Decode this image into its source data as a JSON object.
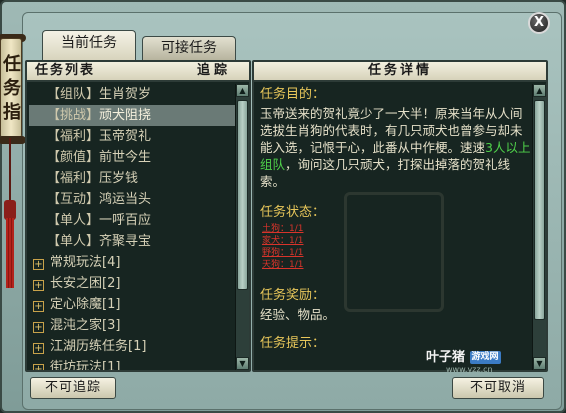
{
  "window": {
    "close_label": "X"
  },
  "side_scroll": {
    "chars": [
      "任",
      "务",
      "指"
    ]
  },
  "tabs": {
    "current": "当前任务",
    "available": "可接任务"
  },
  "left_panel": {
    "header_title": "任务列表",
    "header_track": "追踪",
    "tasks": [
      {
        "category": "【组队】",
        "name": "生肖贺岁",
        "selected": false
      },
      {
        "category": "【挑战】",
        "name": "顽犬阻挠",
        "selected": true
      },
      {
        "category": "【福利】",
        "name": "玉帝贺礼",
        "selected": false
      },
      {
        "category": "【颜值】",
        "name": "前世今生",
        "selected": false
      },
      {
        "category": "【福利】",
        "name": "压岁钱",
        "selected": false
      },
      {
        "category": "【互动】",
        "name": "鸿运当头",
        "selected": false
      },
      {
        "category": "【单人】",
        "name": "一呼百应",
        "selected": false
      },
      {
        "category": "【单人】",
        "name": "齐聚寻宝",
        "selected": false
      }
    ],
    "groups": [
      {
        "icon": "plus-icon",
        "label": "常规玩法[4]"
      },
      {
        "icon": "plus-icon",
        "label": "长安之困[2]"
      },
      {
        "icon": "plus-icon",
        "label": "定心除魔[1]"
      },
      {
        "icon": "plus-icon",
        "label": "混沌之家[3]"
      },
      {
        "icon": "plus-icon",
        "label": "江湖历练任务[1]"
      },
      {
        "icon": "plus-icon",
        "label": "街坊玩法[1]"
      }
    ]
  },
  "right_panel": {
    "header_title": "任务详情",
    "goal_title": "任务目的：",
    "goal_text_1": "玉帝送来的贺礼竟少了一大半！原来当年从人间选拔生肖狗的代表时，有几只顽犬也曾参与却未能入选，记恨于心，此番从中作梗。速速",
    "goal_text_green": "3人以上组队",
    "goal_text_2": "，询问这几只顽犬，打探出掉落的贺礼线索。",
    "status_title": "任务状态：",
    "status_lines": [
      "土狗：1/1",
      "家犬：1/1",
      "野狗：1/1",
      "天狗：1/1"
    ],
    "reward_title": "任务奖励：",
    "reward_text": "经验、物品。",
    "tip_title": "任务提示："
  },
  "buttons": {
    "untrack": "不可追踪",
    "cancel": "不可取消"
  },
  "watermark": {
    "brand": "叶子猪",
    "badge": "游戏网",
    "url": "www.yzz.cn"
  }
}
